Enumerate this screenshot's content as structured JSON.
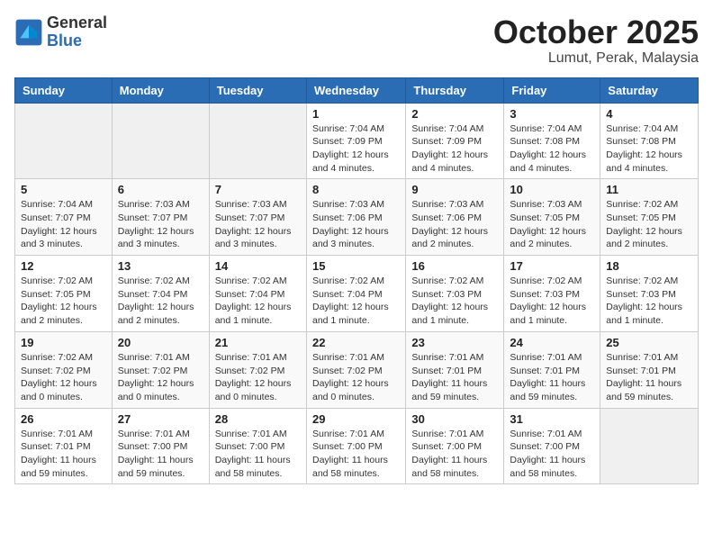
{
  "header": {
    "logo_general": "General",
    "logo_blue": "Blue",
    "title": "October 2025",
    "subtitle": "Lumut, Perak, Malaysia"
  },
  "weekdays": [
    "Sunday",
    "Monday",
    "Tuesday",
    "Wednesday",
    "Thursday",
    "Friday",
    "Saturday"
  ],
  "weeks": [
    [
      {
        "day": "",
        "info": ""
      },
      {
        "day": "",
        "info": ""
      },
      {
        "day": "",
        "info": ""
      },
      {
        "day": "1",
        "info": "Sunrise: 7:04 AM\nSunset: 7:09 PM\nDaylight: 12 hours\nand 4 minutes."
      },
      {
        "day": "2",
        "info": "Sunrise: 7:04 AM\nSunset: 7:09 PM\nDaylight: 12 hours\nand 4 minutes."
      },
      {
        "day": "3",
        "info": "Sunrise: 7:04 AM\nSunset: 7:08 PM\nDaylight: 12 hours\nand 4 minutes."
      },
      {
        "day": "4",
        "info": "Sunrise: 7:04 AM\nSunset: 7:08 PM\nDaylight: 12 hours\nand 4 minutes."
      }
    ],
    [
      {
        "day": "5",
        "info": "Sunrise: 7:04 AM\nSunset: 7:07 PM\nDaylight: 12 hours\nand 3 minutes."
      },
      {
        "day": "6",
        "info": "Sunrise: 7:03 AM\nSunset: 7:07 PM\nDaylight: 12 hours\nand 3 minutes."
      },
      {
        "day": "7",
        "info": "Sunrise: 7:03 AM\nSunset: 7:07 PM\nDaylight: 12 hours\nand 3 minutes."
      },
      {
        "day": "8",
        "info": "Sunrise: 7:03 AM\nSunset: 7:06 PM\nDaylight: 12 hours\nand 3 minutes."
      },
      {
        "day": "9",
        "info": "Sunrise: 7:03 AM\nSunset: 7:06 PM\nDaylight: 12 hours\nand 2 minutes."
      },
      {
        "day": "10",
        "info": "Sunrise: 7:03 AM\nSunset: 7:05 PM\nDaylight: 12 hours\nand 2 minutes."
      },
      {
        "day": "11",
        "info": "Sunrise: 7:02 AM\nSunset: 7:05 PM\nDaylight: 12 hours\nand 2 minutes."
      }
    ],
    [
      {
        "day": "12",
        "info": "Sunrise: 7:02 AM\nSunset: 7:05 PM\nDaylight: 12 hours\nand 2 minutes."
      },
      {
        "day": "13",
        "info": "Sunrise: 7:02 AM\nSunset: 7:04 PM\nDaylight: 12 hours\nand 2 minutes."
      },
      {
        "day": "14",
        "info": "Sunrise: 7:02 AM\nSunset: 7:04 PM\nDaylight: 12 hours\nand 1 minute."
      },
      {
        "day": "15",
        "info": "Sunrise: 7:02 AM\nSunset: 7:04 PM\nDaylight: 12 hours\nand 1 minute."
      },
      {
        "day": "16",
        "info": "Sunrise: 7:02 AM\nSunset: 7:03 PM\nDaylight: 12 hours\nand 1 minute."
      },
      {
        "day": "17",
        "info": "Sunrise: 7:02 AM\nSunset: 7:03 PM\nDaylight: 12 hours\nand 1 minute."
      },
      {
        "day": "18",
        "info": "Sunrise: 7:02 AM\nSunset: 7:03 PM\nDaylight: 12 hours\nand 1 minute."
      }
    ],
    [
      {
        "day": "19",
        "info": "Sunrise: 7:02 AM\nSunset: 7:02 PM\nDaylight: 12 hours\nand 0 minutes."
      },
      {
        "day": "20",
        "info": "Sunrise: 7:01 AM\nSunset: 7:02 PM\nDaylight: 12 hours\nand 0 minutes."
      },
      {
        "day": "21",
        "info": "Sunrise: 7:01 AM\nSunset: 7:02 PM\nDaylight: 12 hours\nand 0 minutes."
      },
      {
        "day": "22",
        "info": "Sunrise: 7:01 AM\nSunset: 7:02 PM\nDaylight: 12 hours\nand 0 minutes."
      },
      {
        "day": "23",
        "info": "Sunrise: 7:01 AM\nSunset: 7:01 PM\nDaylight: 11 hours\nand 59 minutes."
      },
      {
        "day": "24",
        "info": "Sunrise: 7:01 AM\nSunset: 7:01 PM\nDaylight: 11 hours\nand 59 minutes."
      },
      {
        "day": "25",
        "info": "Sunrise: 7:01 AM\nSunset: 7:01 PM\nDaylight: 11 hours\nand 59 minutes."
      }
    ],
    [
      {
        "day": "26",
        "info": "Sunrise: 7:01 AM\nSunset: 7:01 PM\nDaylight: 11 hours\nand 59 minutes."
      },
      {
        "day": "27",
        "info": "Sunrise: 7:01 AM\nSunset: 7:00 PM\nDaylight: 11 hours\nand 59 minutes."
      },
      {
        "day": "28",
        "info": "Sunrise: 7:01 AM\nSunset: 7:00 PM\nDaylight: 11 hours\nand 58 minutes."
      },
      {
        "day": "29",
        "info": "Sunrise: 7:01 AM\nSunset: 7:00 PM\nDaylight: 11 hours\nand 58 minutes."
      },
      {
        "day": "30",
        "info": "Sunrise: 7:01 AM\nSunset: 7:00 PM\nDaylight: 11 hours\nand 58 minutes."
      },
      {
        "day": "31",
        "info": "Sunrise: 7:01 AM\nSunset: 7:00 PM\nDaylight: 11 hours\nand 58 minutes."
      },
      {
        "day": "",
        "info": ""
      }
    ]
  ]
}
